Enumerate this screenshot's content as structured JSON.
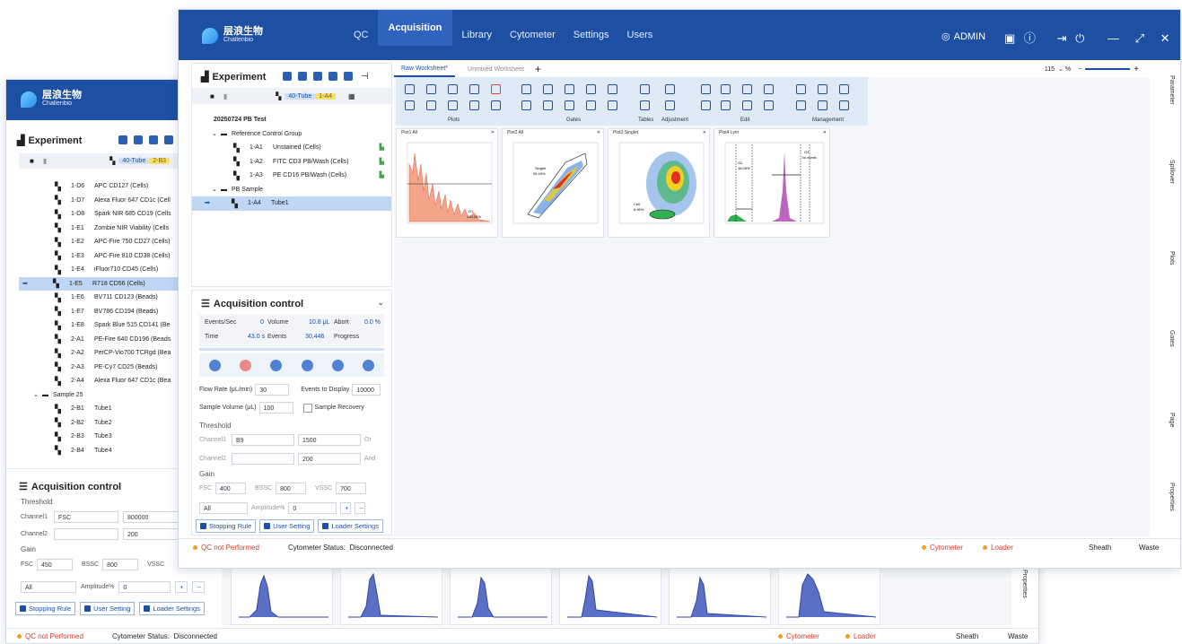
{
  "app": {
    "logo_cn": "层浪生物",
    "logo_en": "Challenbio",
    "menu": [
      "QC",
      "Acquisition",
      "Library",
      "Cytometer",
      "Settings",
      "Users"
    ],
    "user": "ADMIN"
  },
  "experiment": {
    "title": "Experiment",
    "tube_chip": "40-Tube",
    "tube_chip2": "1-A4",
    "tube_chip2_back": "2-B3",
    "exp_name": "20250724 PB Test",
    "group1": "Reference Control Group",
    "tubes_front": [
      {
        "id": "1-A1",
        "name": "Unstained (Cells)"
      },
      {
        "id": "1-A2",
        "name": "FITC CD3 PB/Wash (Cells)"
      },
      {
        "id": "1-A3",
        "name": "PE CD16 PB/Wash (Cells)"
      }
    ],
    "group2": "PB Sample",
    "selected_front": {
      "id": "1-A4",
      "name": "Tube1"
    },
    "tubes_back": [
      {
        "id": "1-D6",
        "name": "APC CD127 (Cells)"
      },
      {
        "id": "1-D7",
        "name": "Alexa Fluor 647 CD1c (Cell"
      },
      {
        "id": "1-D8",
        "name": "Spark NIR 685 CD19 (Cells"
      },
      {
        "id": "1-E1",
        "name": "Zombie NIR Viability (Cells"
      },
      {
        "id": "1-E2",
        "name": "APC-Fire 750 CD27 (Cells)"
      },
      {
        "id": "1-E3",
        "name": "APC-Fire 810 CD38 (Cells)"
      },
      {
        "id": "1-E4",
        "name": "iFluor710 CD45 (Cells)"
      },
      {
        "id": "1-E5",
        "name": "R718 CD56 (Cells)"
      },
      {
        "id": "1-E6",
        "name": "BV711 CD123 (Beads)"
      },
      {
        "id": "1-E7",
        "name": "BV786 CD194 (Beads)"
      },
      {
        "id": "1-E8",
        "name": "Spark Blue 515 CD141 (Be"
      },
      {
        "id": "2-A1",
        "name": "PE-Fire 640 CD196 (Beads"
      },
      {
        "id": "2-A2",
        "name": "PerCP-Vio700 TCRgd (Bea"
      },
      {
        "id": "2-A3",
        "name": "PE-Cy7 CD25 (Beads)"
      },
      {
        "id": "2-A4",
        "name": "Alexa Fluor 647 CD1c (Bea"
      }
    ],
    "back_group": "Sample 25",
    "tubes_back2": [
      {
        "id": "2-B1",
        "name": "Tube1"
      },
      {
        "id": "2-B2",
        "name": "Tube2"
      },
      {
        "id": "2-B3",
        "name": "Tube3"
      },
      {
        "id": "2-B4",
        "name": "Tube4"
      }
    ]
  },
  "acq": {
    "title": "Acquisition control",
    "events_sec_lbl": "Events/Sec",
    "events_sec": "0",
    "volume_lbl": "Volume",
    "volume": "10.8 μL",
    "abort_lbl": "Abort",
    "abort": "0.0 %",
    "time_lbl": "Time",
    "time": "43.0 s",
    "events_lbl": "Events",
    "events": "30,446",
    "progress_lbl": "Progress",
    "flow_rate_lbl": "Flow Rate (μL/min)",
    "flow_rate": "30",
    "events_display_lbl": "Events to Display",
    "events_display": "10000",
    "sample_vol_lbl": "Sample Volume (μL)",
    "sample_vol": "100",
    "recovery_lbl": "Sample Recovery",
    "threshold_lbl": "Threshold",
    "channel1_lbl": "Channel1",
    "channel1": "B9",
    "channel1_val": "1500",
    "or_lbl": "Or",
    "channel2_lbl": "Channel2",
    "channel2_val": "200",
    "and_lbl": "And",
    "gain_lbl": "Gain",
    "fsc_lbl": "FSC",
    "fsc": "400",
    "bssc_lbl": "BSSC",
    "bssc": "800",
    "vssc_lbl": "VSSC",
    "vssc": "700",
    "all": "All",
    "amp_lbl": "Amplitude%",
    "amp": "0",
    "btn_stop": "Stopping Rule",
    "btn_user": "User Setting",
    "btn_loader": "Loader Settings",
    "back_channel1": "FSC",
    "back_channel1_val": "800000",
    "back_channel2_val": "200",
    "back_fsc": "450",
    "back_bssc": "800"
  },
  "worksheet": {
    "tab1": "Raw Worksheet*",
    "tab2": "Unmixed Worksheet",
    "zoom": "115",
    "groups": [
      "Plots",
      "Gates",
      "Tables",
      "Adjustment",
      "Edit",
      "Management"
    ],
    "plots": [
      {
        "title": "Plot1 All",
        "gate": "G1",
        "pct": "100.00%"
      },
      {
        "title": "Plot2 All",
        "gate": "Singlet",
        "pct": "95.43%"
      },
      {
        "title": "Plot3 Singlet",
        "gate": "Cell",
        "pct": "8.95%"
      },
      {
        "title": "Plot4 Lym",
        "gate": "G2",
        "pct": "18.05%",
        "gate2": "G3",
        "pct2": "No events"
      }
    ]
  },
  "side_tabs": [
    "Parameter",
    "Spillover",
    "Plots",
    "Gates",
    "Page",
    "Properties"
  ],
  "back_side_tab": "Properties",
  "status": {
    "qc": "QC not Performed",
    "cyto_lbl": "Cytometer Status:",
    "cyto_val": "Disconnected",
    "cytometer": "Cytometer",
    "loader": "Loader",
    "sheath": "Sheath",
    "waste": "Waste"
  },
  "colors": {
    "brand": "#1d4fa3",
    "selected": "#bfd6f5",
    "qc_warn": "#d63a2f"
  }
}
